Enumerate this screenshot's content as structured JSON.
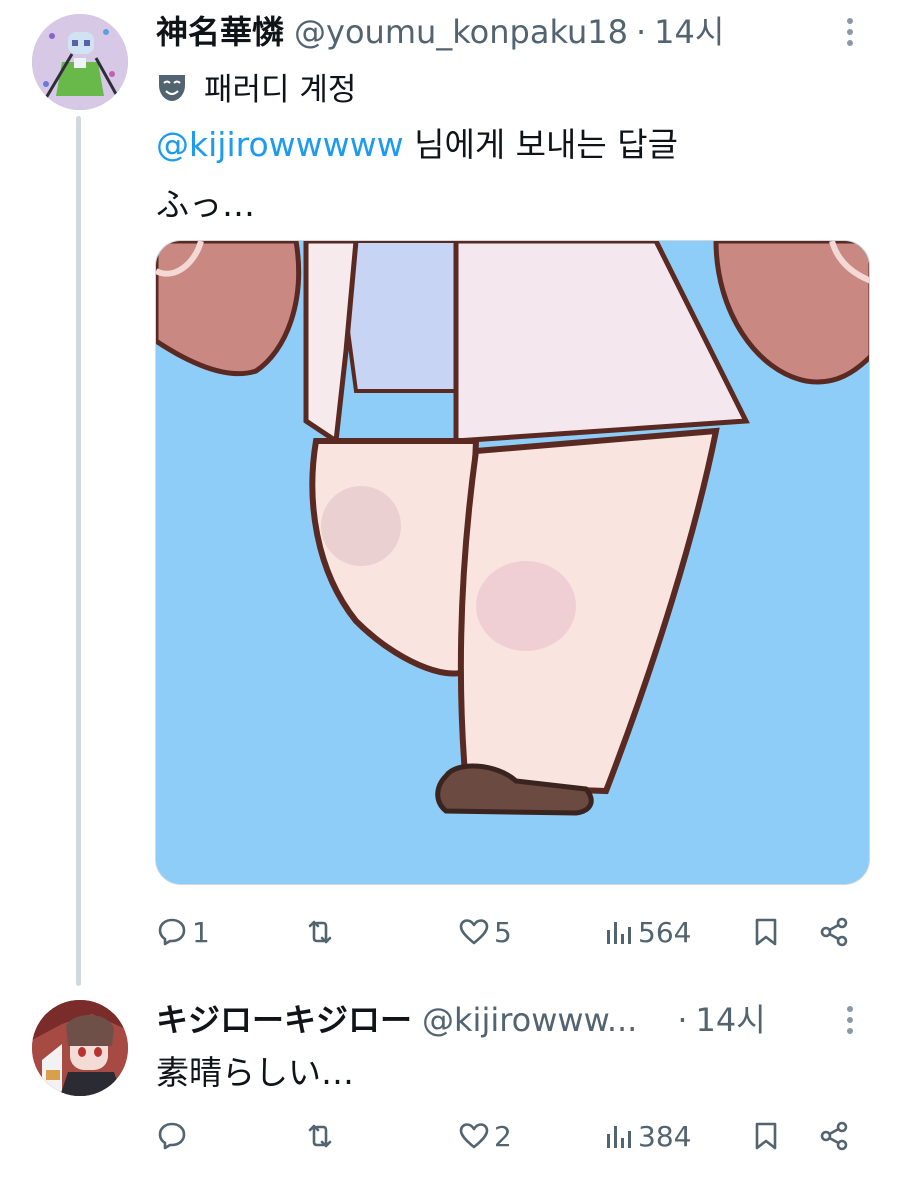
{
  "tweets": [
    {
      "display_name": "神名華憐",
      "handle": "@youmu_konpaku18",
      "separator": "·",
      "time": "14시",
      "parody_label": "패러디 계정",
      "reply_to_handle": "@kijirowwwww",
      "reply_to_suffix": " 님에게 보내는 답글",
      "text": "ふっ…",
      "stats": {
        "replies": "1",
        "retweets": "",
        "likes": "5",
        "views": "564"
      }
    },
    {
      "display_name": "キジローキジロー",
      "handle": "@kijirowww...",
      "separator": "·",
      "time": "14시",
      "text": "素晴らしい…",
      "stats": {
        "replies": "",
        "retweets": "",
        "likes": "2",
        "views": "384"
      }
    }
  ],
  "icons": {
    "more": "more-vertical-icon",
    "parody": "theater-mask-icon",
    "reply": "speech-bubble-icon",
    "retweet": "retweet-icon",
    "like": "heart-icon",
    "views": "bar-chart-icon",
    "bookmark": "bookmark-icon",
    "share": "share-icon"
  },
  "colors": {
    "text": "#0f1419",
    "secondary": "#536471",
    "link": "#1d9bf0",
    "thread_line": "#cfd9de",
    "media_background": "#8ecdf8"
  }
}
